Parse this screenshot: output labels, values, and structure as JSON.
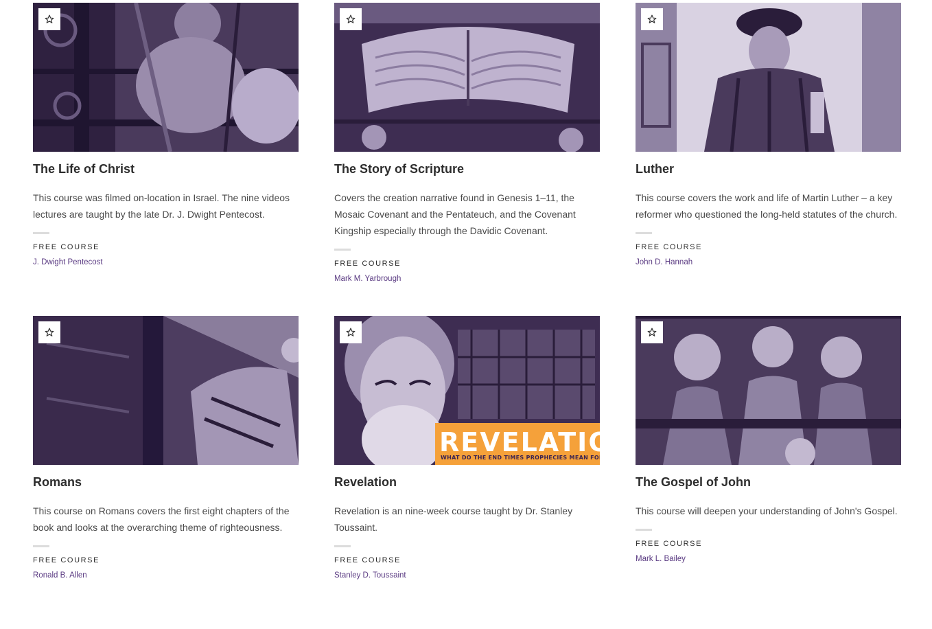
{
  "courses": [
    {
      "title": "The Life of Christ",
      "description": "This course was filmed on-location in Israel. The nine videos lectures are taught by the late Dr. J. Dwight Pentecost.",
      "tag": "FREE COURSE",
      "author": "J. Dwight Pentecost",
      "icon": "star-icon"
    },
    {
      "title": "The Story of Scripture",
      "description": "Covers the creation narrative found in Genesis 1–11, the Mosaic Covenant and the Pentateuch, and the Covenant Kingship especially through the Davidic Covenant.",
      "tag": "FREE COURSE",
      "author": "Mark M. Yarbrough",
      "icon": "star-icon"
    },
    {
      "title": "Luther",
      "description": "This course covers the work and life of Martin Luther – a key reformer who questioned the long-held statutes of the church.",
      "tag": "FREE COURSE",
      "author": "John D. Hannah",
      "icon": "star-icon"
    },
    {
      "title": "Romans",
      "description": "This course on Romans covers the first eight chapters of the book and looks at the overarching theme of righteousness.",
      "tag": "FREE COURSE",
      "author": "Ronald B. Allen",
      "icon": "star-icon"
    },
    {
      "title": "Revelation",
      "description": "Revelation is an nine-week course taught by Dr. Stanley Toussaint.",
      "tag": "FREE COURSE",
      "author": "Stanley D. Toussaint",
      "icon": "star-icon",
      "banner_title": "REVELATION",
      "banner_subtitle": "WHAT DO THE END TIMES PROPHECIES MEAN FOR YOU?"
    },
    {
      "title": "The Gospel of John",
      "description": "This course will deepen your understanding of John's Gospel.",
      "tag": "FREE COURSE",
      "author": "Mark L. Bailey",
      "icon": "star-icon"
    }
  ],
  "colors": {
    "author_link": "#5a3a82",
    "image_tint": "#3a2a4a",
    "banner": "#f5a13a"
  }
}
